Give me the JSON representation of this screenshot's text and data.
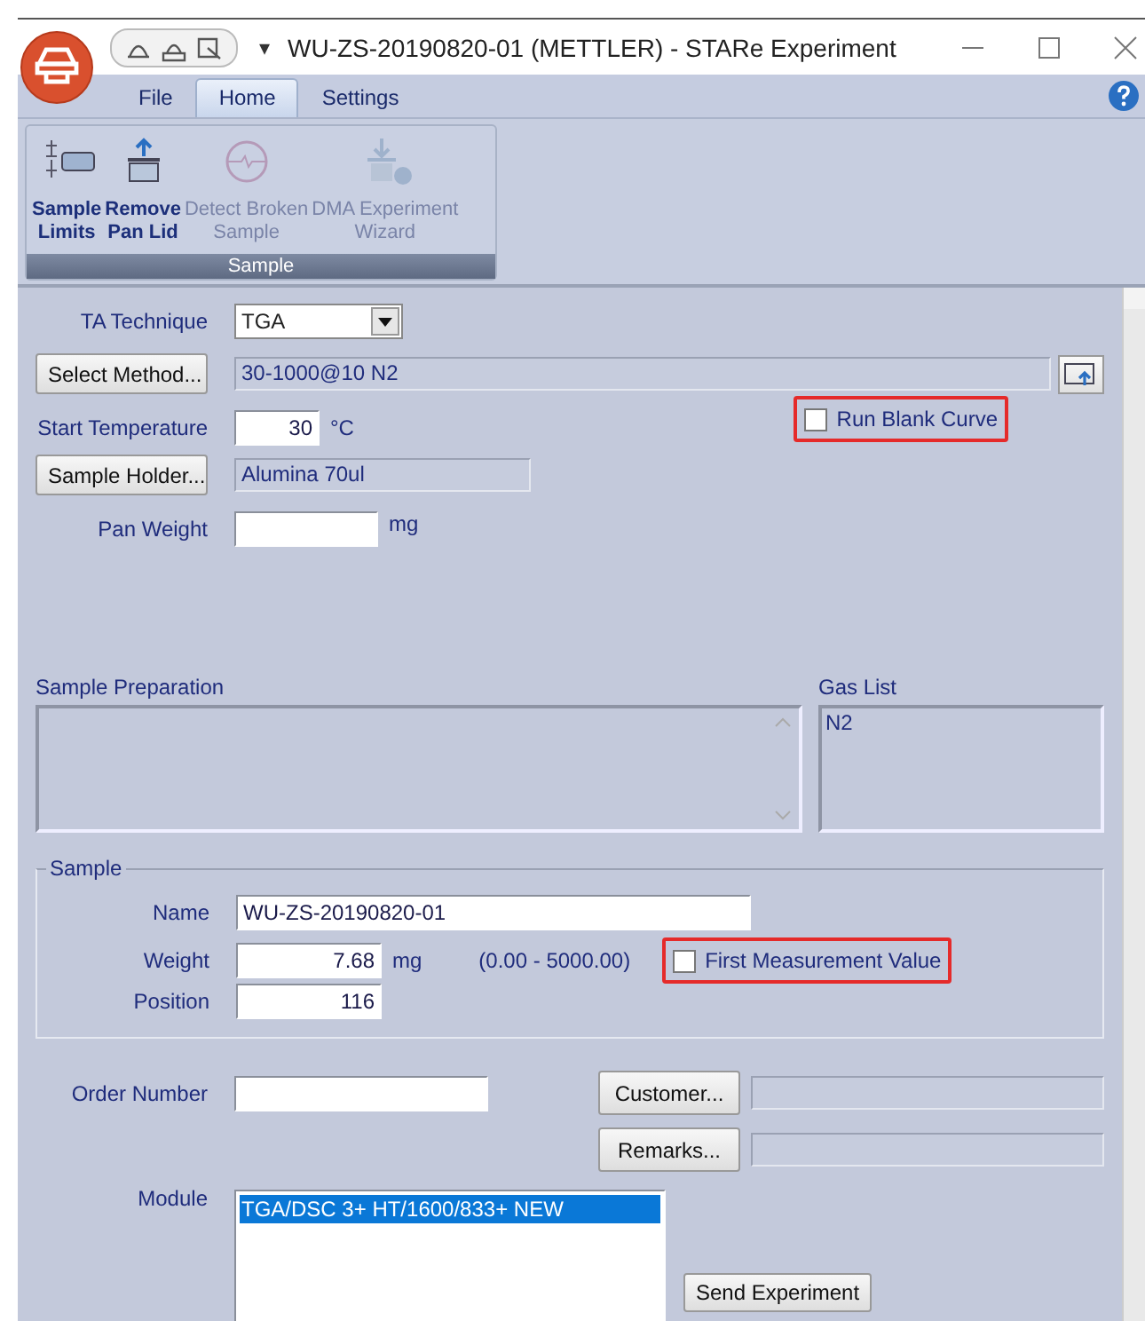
{
  "window": {
    "title": "WU-ZS-20190820-01 (METTLER) - STARe Experiment",
    "quick_access_menu": "▾"
  },
  "ribbon": {
    "tabs": [
      {
        "label": "File",
        "selected": false
      },
      {
        "label": "Home",
        "selected": true
      },
      {
        "label": "Settings",
        "selected": false
      }
    ],
    "groups": [
      {
        "label": "Sample",
        "buttons": [
          {
            "kind": "limits",
            "lines": [
              "Sample",
              "Limits"
            ],
            "disabled": false
          },
          {
            "kind": "lid",
            "lines": [
              "Remove",
              "Pan Lid"
            ],
            "disabled": false
          },
          {
            "kind": "broken",
            "lines": [
              "Detect Broken",
              "Sample"
            ],
            "disabled": true
          },
          {
            "kind": "wizard",
            "lines": [
              "DMA Experiment",
              "Wizard"
            ],
            "disabled": true
          }
        ]
      }
    ]
  },
  "form": {
    "ta_technique": {
      "label": "TA Technique",
      "value": "TGA"
    },
    "method": {
      "button": "Select Method...",
      "value": "30-1000@10 N2"
    },
    "start_temperature": {
      "label": "Start Temperature",
      "value": "30",
      "unit": "°C"
    },
    "run_blank_curve": {
      "label": "Run Blank Curve",
      "checked": false,
      "highlighted": true
    },
    "sample_holder": {
      "button": "Sample Holder...",
      "value": "Alumina 70ul"
    },
    "pan_weight": {
      "label": "Pan Weight",
      "unit": "mg"
    },
    "sample_preparation": {
      "label": "Sample Preparation"
    },
    "gas_list": {
      "label": "Gas List",
      "items": [
        "N2"
      ]
    },
    "sample": {
      "legend": "Sample",
      "name": {
        "label": "Name",
        "value": "WU-ZS-20190820-01"
      },
      "weight": {
        "label": "Weight",
        "value": "7.68",
        "unit": "mg",
        "range": "(0.00 - 5000.00)"
      },
      "first_measurement_value": {
        "label": "First Measurement Value",
        "checked": false,
        "highlighted": true
      },
      "position": {
        "label": "Position",
        "value": "116"
      }
    },
    "order_number": {
      "label": "Order Number"
    },
    "customer": {
      "button": "Customer..."
    },
    "remarks": {
      "button": "Remarks..."
    },
    "module": {
      "label": "Module",
      "items": [
        {
          "label": "TGA/DSC 3+ HT/1600/833+ NEW",
          "selected": true
        }
      ]
    },
    "send_button": "Send Experiment"
  }
}
